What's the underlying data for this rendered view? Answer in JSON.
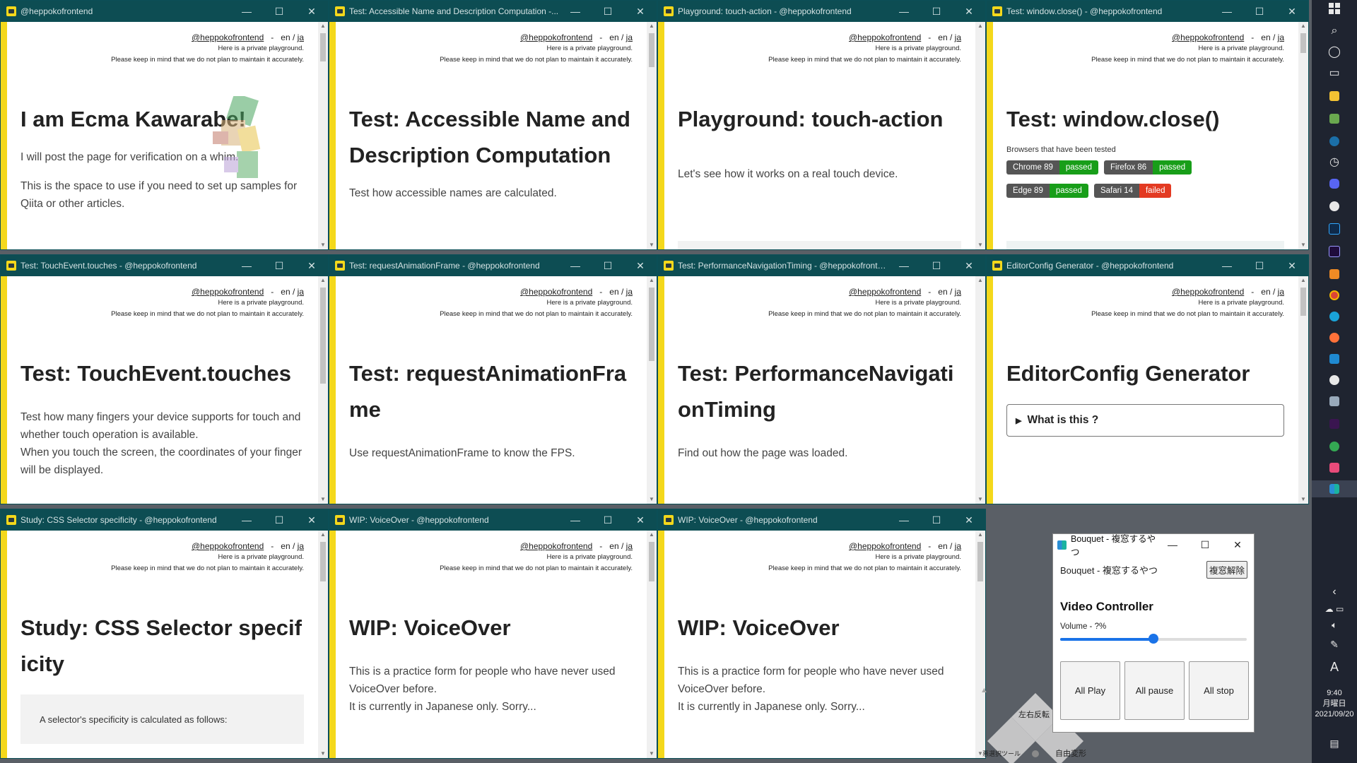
{
  "common": {
    "handle": "@heppokofrontend",
    "separator": "-",
    "lang_en": "en",
    "lang_slash": " / ",
    "lang_ja": "ja",
    "note1": "Here is a private playground.",
    "note2": "Please keep in mind that we do not plan to maintain it accurately.",
    "minimize": "—",
    "maximize": "☐",
    "close": "✕"
  },
  "windows": [
    {
      "title": "@heppokofrontend",
      "heading": "I am Ecma Kawarabe!",
      "p1": "I will post the page for verification on a whim.",
      "p2": "This is the space to use if you need to set up samples for Qiita or other articles."
    },
    {
      "title": "Test: Accessible Name and Description Computation -...",
      "heading": "Test: Accessible Name and Description Computation",
      "p1": "Test how accessible names are calculated."
    },
    {
      "title": "Playground: touch-action - @heppokofrontend",
      "heading": "Playground: touch-action",
      "p1": "Let's see how it works on a real touch device."
    },
    {
      "title": "Test: window.close() - @heppokofrontend",
      "heading": "Test: window.close()",
      "browsers_label": "Browsers that have been tested",
      "badges": [
        {
          "name": "Chrome 89",
          "status": "passed"
        },
        {
          "name": "Firefox 86",
          "status": "passed"
        },
        {
          "name": "Edge 89",
          "status": "passed"
        },
        {
          "name": "Safari 14",
          "status": "failed"
        }
      ]
    },
    {
      "title": "Test: TouchEvent.touches - @heppokofrontend",
      "heading": "Test: TouchEvent.touches",
      "p1": "Test how many fingers your device supports for touch and whether touch operation is available.",
      "p2": "When you touch the screen, the coordinates of your finger will be displayed."
    },
    {
      "title": "Test: requestAnimationFrame - @heppokofrontend",
      "heading": "Test: requestAnimationFrame",
      "p1": "Use requestAnimationFrame to know the FPS."
    },
    {
      "title": "Test: PerformanceNavigationTiming - @heppokofronte...",
      "heading": "Test: PerformanceNavigationTiming",
      "p1": "Find out how the page was loaded."
    },
    {
      "title": "EditorConfig Generator - @heppokofrontend",
      "heading": "EditorConfig Generator",
      "details": "What is this ?"
    },
    {
      "title": "Study: CSS Selector specificity - @heppokofrontend",
      "heading": "Study: CSS Selector specificity",
      "quote": "A selector's specificity is calculated as follows:"
    },
    {
      "title": "WIP: VoiceOver - @heppokofrontend",
      "heading": "WIP: VoiceOver",
      "p1": "This is a practice form for people who have never used VoiceOver before.",
      "p2": "It is currently in Japanese only. Sorry..."
    },
    {
      "title": "WIP: VoiceOver - @heppokofrontend",
      "heading": "WIP: VoiceOver",
      "p1": "This is a practice form for people who have never used VoiceOver before.",
      "p2": "It is currently in Japanese only. Sorry..."
    }
  ],
  "bouquet": {
    "title": "Bouquet - 複窓するやつ",
    "app_label": "Bouquet - 複窓するやつ",
    "release_button": "複窓解除",
    "heading": "Video Controller",
    "volume_label": "Volume - ?%",
    "volume_fraction": 0.5,
    "buttons": [
      "All Play",
      "All pause",
      "All stop"
    ]
  },
  "snap_overlay": {
    "top": "左右反転",
    "bottom_left": "悪選択ツール",
    "bottom_right": "自由変形"
  },
  "clock": {
    "time": "9:40",
    "day": "月曜日",
    "date": "2021/09/20"
  },
  "taskbar": {
    "keyboard": "A"
  }
}
